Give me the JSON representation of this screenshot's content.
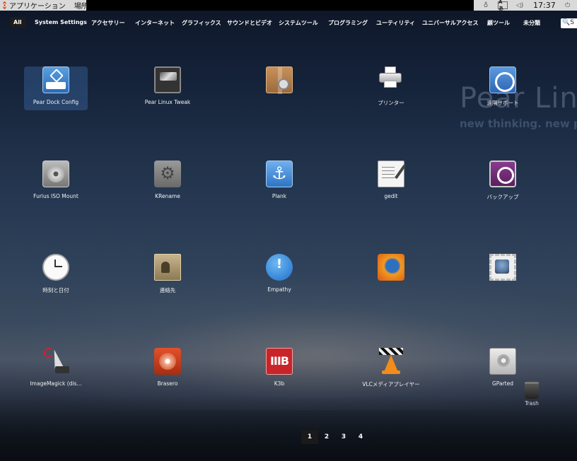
{
  "top_panel": {
    "menu_applications": "アプリケーション",
    "menu_places": "場所",
    "clock": "17:37",
    "keyboard_indicator": "Aあ"
  },
  "branding": {
    "title": "Pear Lin",
    "subtitle": "new thinking. new p"
  },
  "categories": [
    {
      "label": "All",
      "active": true
    },
    {
      "label": "System Settings"
    },
    {
      "label": "アクセサリー"
    },
    {
      "label": "インターネット"
    },
    {
      "label": "グラフィックス"
    },
    {
      "label": "サウンドとビデオ"
    },
    {
      "label": "システムツール"
    },
    {
      "label": "プログラミング"
    },
    {
      "label": "ユーティリティ"
    },
    {
      "label": "ユニバーサルアクセス"
    },
    {
      "label": "顧ツール"
    },
    {
      "label": "未分類"
    }
  ],
  "search": {
    "placeholder": "S"
  },
  "apps": [
    {
      "label": "Pear Dock Config",
      "icon": "dock-config-icon",
      "selected": true
    },
    {
      "label": "Pear Linux Tweak",
      "icon": "monitor-tweak-icon"
    },
    {
      "label": "",
      "icon": "package-box-icon"
    },
    {
      "label": "プリンター",
      "icon": "printer-icon"
    },
    {
      "label": "遠隔サポート",
      "icon": "remote-support-icon"
    },
    {
      "label": "Furius ISO Mount",
      "icon": "disc-mount-icon"
    },
    {
      "label": "KRename",
      "icon": "gear-icon"
    },
    {
      "label": "Plank",
      "icon": "anchor-icon"
    },
    {
      "label": "gedit",
      "icon": "text-editor-icon"
    },
    {
      "label": "バックアップ",
      "icon": "backup-icon"
    },
    {
      "label": "時刻と日付",
      "icon": "clock-icon"
    },
    {
      "label": "連絡先",
      "icon": "contacts-icon"
    },
    {
      "label": "Empathy",
      "icon": "chat-bubble-icon"
    },
    {
      "label": "",
      "icon": "firefox-icon"
    },
    {
      "label": "",
      "icon": "mail-stamp-icon"
    },
    {
      "label": "ImageMagick (dis...",
      "icon": "wizard-hat-icon"
    },
    {
      "label": "Brasero",
      "icon": "burn-disc-icon"
    },
    {
      "label": "K3b",
      "icon": "k3b-icon"
    },
    {
      "label": "VLCメディアプレイヤー",
      "icon": "vlc-cone-icon"
    },
    {
      "label": "GParted",
      "icon": "partition-disk-icon"
    }
  ],
  "trash": {
    "label": "Trash"
  },
  "pages": [
    "1",
    "2",
    "3",
    "4"
  ],
  "active_page": "1"
}
